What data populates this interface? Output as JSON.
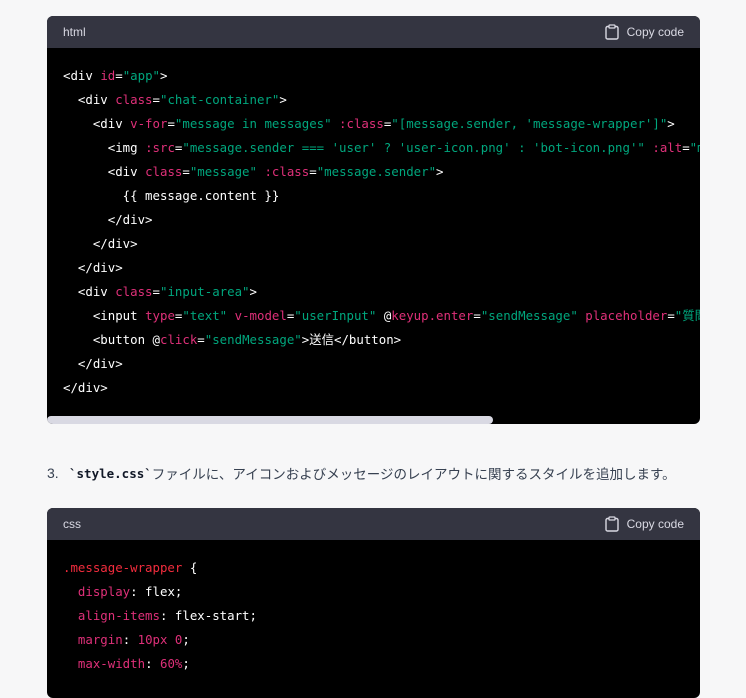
{
  "copy_label": "Copy code",
  "colors": {
    "page_bg": "#f7f7f8",
    "header_bg": "#343541",
    "code_bg": "#000000",
    "tag": "#ffffff",
    "attr": "#df3079",
    "string": "#00a67d",
    "punct": "#ffffff",
    "selector": "#f22c3d",
    "property": "#df3079",
    "number": "#df3079",
    "scrollbar": "#d9d9e3"
  },
  "html_block": {
    "lang": "html",
    "lines": [
      [
        [
          "t",
          "<div "
        ],
        [
          "a",
          "id"
        ],
        [
          "t",
          "="
        ],
        [
          "s",
          "\"app\""
        ],
        [
          "t",
          ">"
        ]
      ],
      [
        [
          "t",
          "  <div "
        ],
        [
          "a",
          "class"
        ],
        [
          "t",
          "="
        ],
        [
          "s",
          "\"chat-container\""
        ],
        [
          "t",
          ">"
        ]
      ],
      [
        [
          "t",
          "    <div "
        ],
        [
          "a",
          "v-for"
        ],
        [
          "t",
          "="
        ],
        [
          "s",
          "\"message in messages\""
        ],
        [
          "t",
          " "
        ],
        [
          "a",
          ":class"
        ],
        [
          "t",
          "="
        ],
        [
          "s",
          "\"[message.sender, 'message-wrapper']\""
        ],
        [
          "t",
          ">"
        ]
      ],
      [
        [
          "t",
          "      <img "
        ],
        [
          "a",
          ":src"
        ],
        [
          "t",
          "="
        ],
        [
          "s",
          "\"message.sender === 'user' ? 'user-icon.png' : 'bot-icon.png'\""
        ],
        [
          "t",
          " "
        ],
        [
          "a",
          ":alt"
        ],
        [
          "t",
          "="
        ],
        [
          "s",
          "\"messag"
        ]
      ],
      [
        [
          "t",
          "      <div "
        ],
        [
          "a",
          "class"
        ],
        [
          "t",
          "="
        ],
        [
          "s",
          "\"message\""
        ],
        [
          "t",
          " "
        ],
        [
          "a",
          ":class"
        ],
        [
          "t",
          "="
        ],
        [
          "s",
          "\"message.sender\""
        ],
        [
          "t",
          ">"
        ]
      ],
      [
        [
          "t",
          "        {{ message.content }}"
        ]
      ],
      [
        [
          "t",
          "      </div>"
        ]
      ],
      [
        [
          "t",
          "    </div>"
        ]
      ],
      [
        [
          "t",
          "  </div>"
        ]
      ],
      [
        [
          "t",
          "  <div "
        ],
        [
          "a",
          "class"
        ],
        [
          "t",
          "="
        ],
        [
          "s",
          "\"input-area\""
        ],
        [
          "t",
          ">"
        ]
      ],
      [
        [
          "t",
          "    <input "
        ],
        [
          "a",
          "type"
        ],
        [
          "t",
          "="
        ],
        [
          "s",
          "\"text\""
        ],
        [
          "t",
          " "
        ],
        [
          "a",
          "v-model"
        ],
        [
          "t",
          "="
        ],
        [
          "s",
          "\"userInput\""
        ],
        [
          "t",
          " @"
        ],
        [
          "a",
          "keyup.enter"
        ],
        [
          "t",
          "="
        ],
        [
          "s",
          "\"sendMessage\""
        ],
        [
          "t",
          " "
        ],
        [
          "a",
          "placeholder"
        ],
        [
          "t",
          "="
        ],
        [
          "s",
          "\"質問を入"
        ]
      ],
      [
        [
          "t",
          "    <button @"
        ],
        [
          "a",
          "click"
        ],
        [
          "t",
          "="
        ],
        [
          "s",
          "\"sendMessage\""
        ],
        [
          "t",
          ">送信</button>"
        ]
      ],
      [
        [
          "t",
          "  </div>"
        ]
      ],
      [
        [
          "t",
          "</div>"
        ]
      ]
    ]
  },
  "step": {
    "number": "3.",
    "code": "`style.css`",
    "text": "ファイルに、アイコンおよびメッセージのレイアウトに関するスタイルを追加します。"
  },
  "css_block": {
    "lang": "css",
    "lines": [
      [
        [
          "sel",
          ".message-wrapper"
        ],
        [
          "t",
          " {"
        ]
      ],
      [
        [
          "t",
          "  "
        ],
        [
          "p",
          "display"
        ],
        [
          "t",
          ": flex;"
        ]
      ],
      [
        [
          "t",
          "  "
        ],
        [
          "p",
          "align-items"
        ],
        [
          "t",
          ": flex-start;"
        ]
      ],
      [
        [
          "t",
          "  "
        ],
        [
          "p",
          "margin"
        ],
        [
          "t",
          ": "
        ],
        [
          "n",
          "10px 0"
        ],
        [
          "t",
          ";"
        ]
      ],
      [
        [
          "t",
          "  "
        ],
        [
          "p",
          "max-width"
        ],
        [
          "t",
          ": "
        ],
        [
          "n",
          "60%"
        ],
        [
          "t",
          ";"
        ]
      ]
    ]
  }
}
